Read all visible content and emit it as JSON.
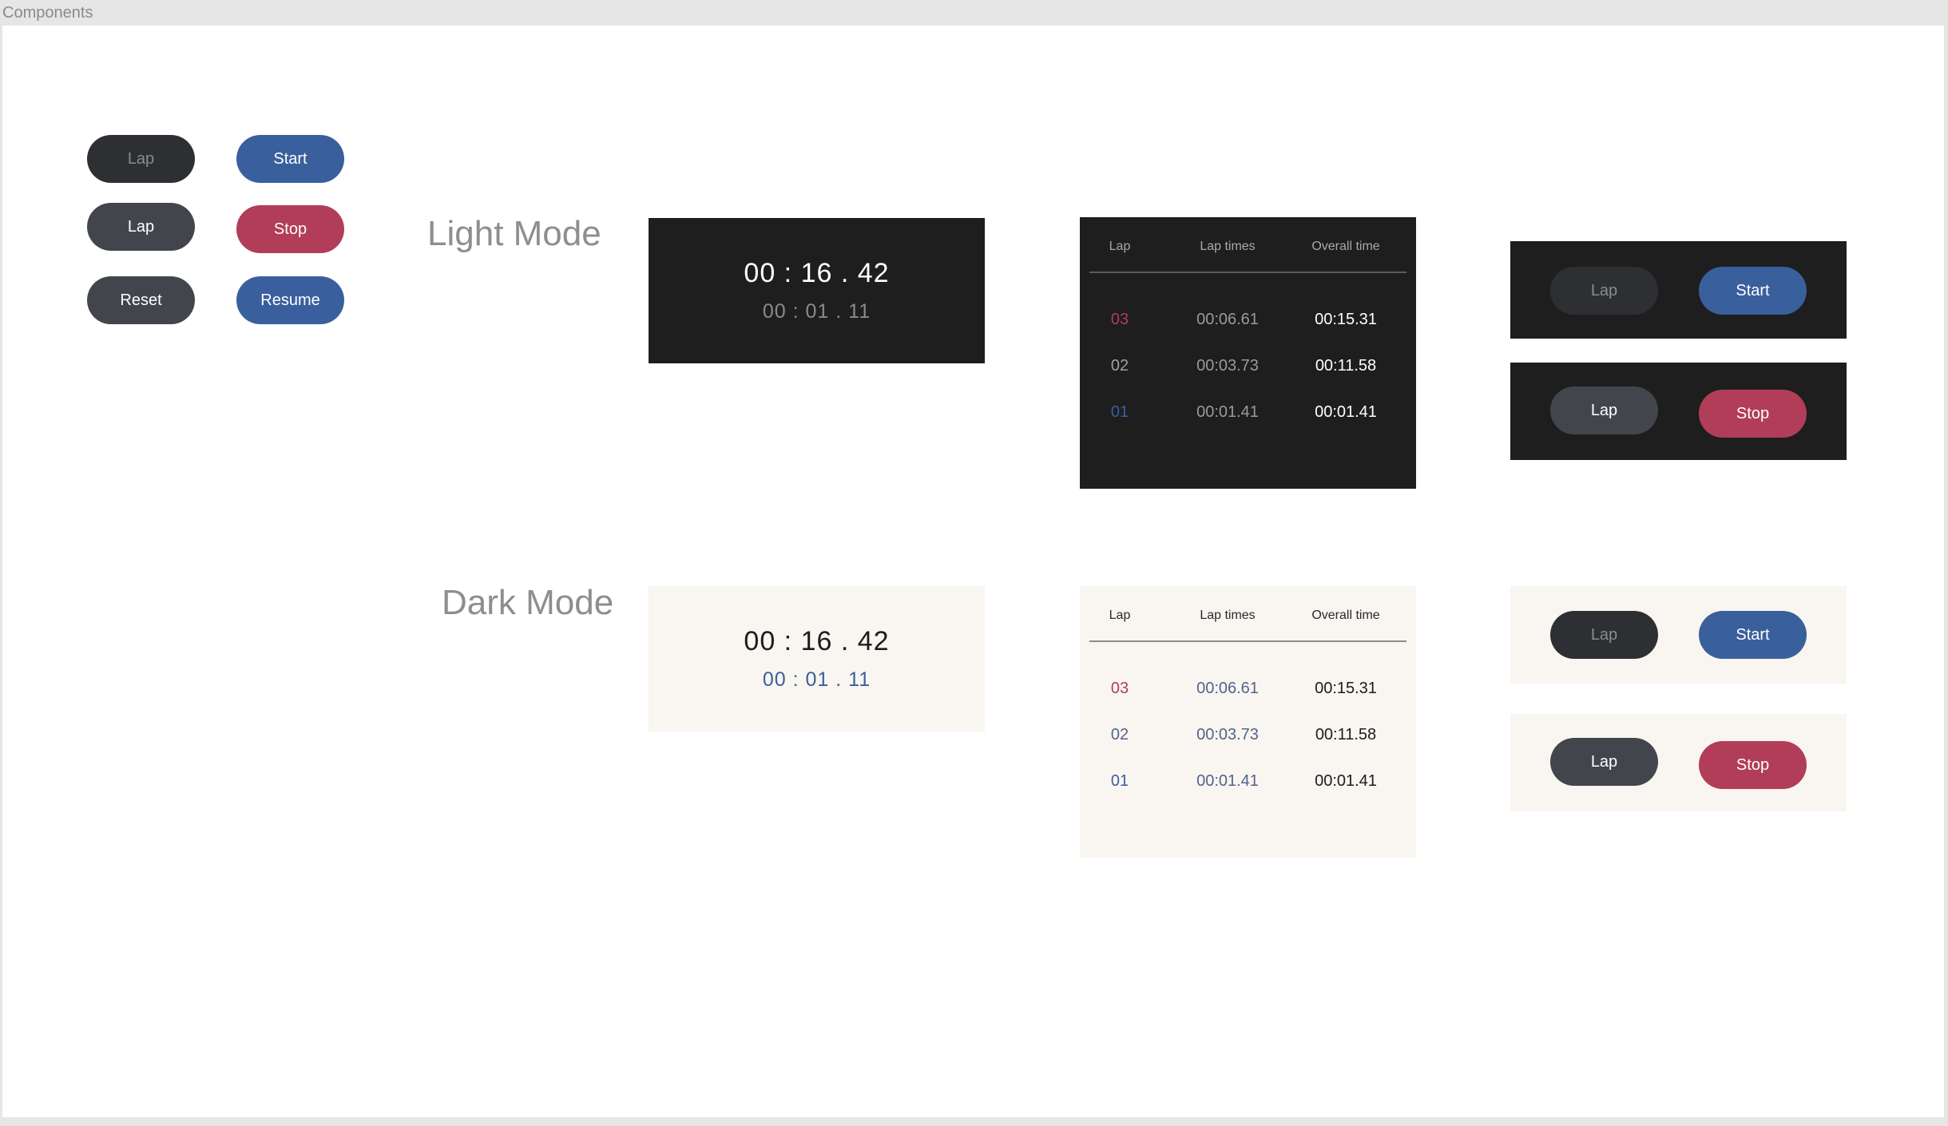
{
  "frame": {
    "label": "Components"
  },
  "palette": {
    "dark_panel": "#1e1e1e",
    "light_panel": "#f9f5f0",
    "primary": "#3a5f9d",
    "danger": "#b23d58",
    "neutral": "#42464c",
    "disabled": "#2d2f33"
  },
  "buttons": {
    "lap": "Lap",
    "start": "Start",
    "stop": "Stop",
    "reset": "Reset",
    "resume": "Resume"
  },
  "sections": {
    "light_mode": "Light Mode",
    "dark_mode": "Dark Mode"
  },
  "timer": {
    "main": "00 : 16 . 42",
    "lap": "00 : 01 . 11"
  },
  "lap_table": {
    "headers": [
      "Lap",
      "Lap times",
      "Overall time"
    ],
    "rows": [
      {
        "lap": "03",
        "lap_time": "00:06.61",
        "overall": "00:15.31"
      },
      {
        "lap": "02",
        "lap_time": "00:03.73",
        "overall": "00:11.58"
      },
      {
        "lap": "01",
        "lap_time": "00:01.41",
        "overall": "00:01.41"
      }
    ]
  }
}
